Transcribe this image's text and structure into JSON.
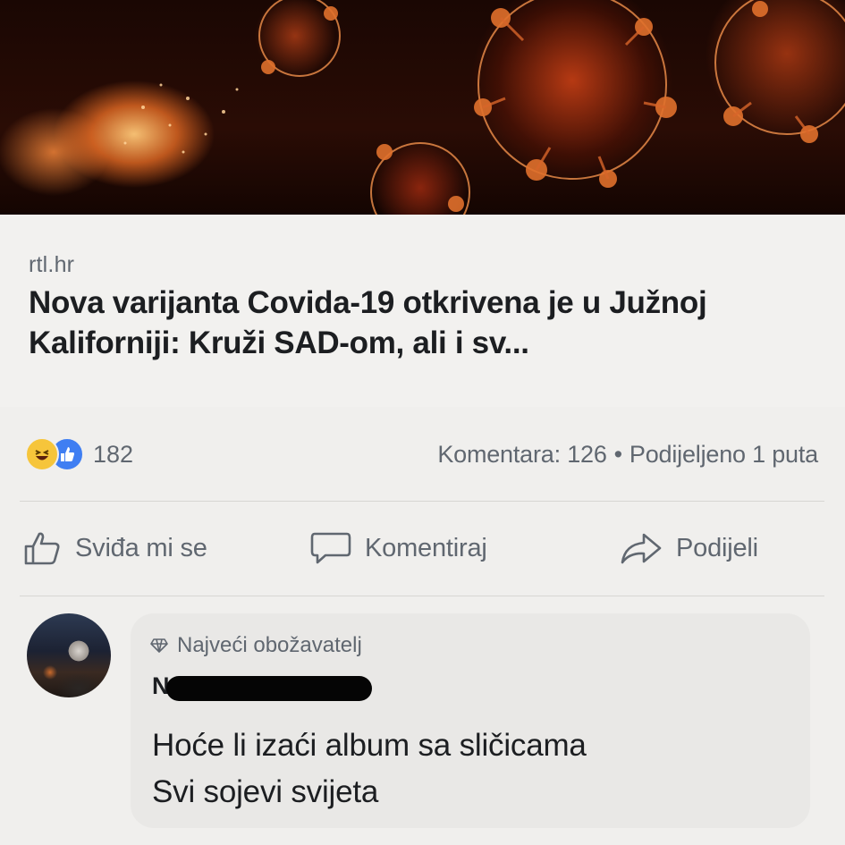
{
  "post": {
    "link": {
      "domain": "rtl.hr",
      "headline": "Nova varijanta Covida-19 otkrivena je u Južnoj Kaliforniji: Kruži SAD-om, ali i sv..."
    },
    "stats": {
      "reaction_icons": [
        "haha-icon",
        "like-icon"
      ],
      "reaction_count": "182",
      "comments": "Komentara: 126",
      "separator": "•",
      "shares": "Podijeljeno 1 puta"
    },
    "actions": {
      "like_label": "Sviđa mi se",
      "comment_label": "Komentiraj",
      "share_label": "Podijeli"
    }
  },
  "comment": {
    "badge": "Najveći obožavatelj",
    "author_visible": "N",
    "lines": [
      "Hoće li izaći album sa sličicama",
      "Svi sojevi svijeta"
    ]
  },
  "colors": {
    "text_primary": "#1c1e21",
    "text_secondary": "#606770",
    "like_blue": "#3f7ef2",
    "haha_yellow": "#f6c53b"
  }
}
